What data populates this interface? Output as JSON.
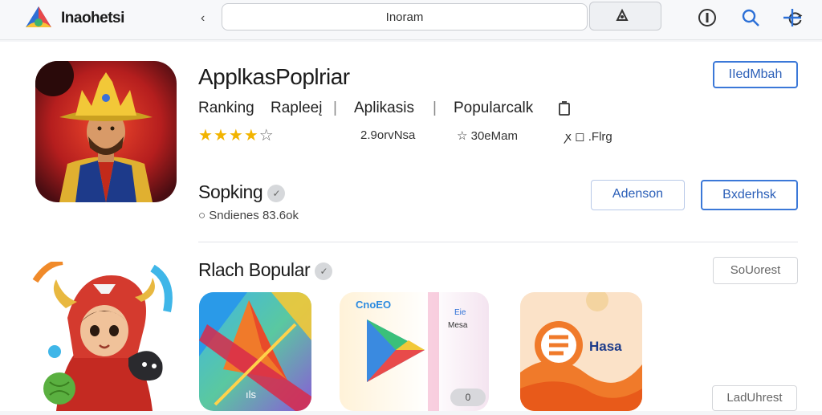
{
  "topbar": {
    "brand": "Inaohetsi",
    "back_glyph": "‹",
    "url": "Inoram",
    "icons": [
      "reload-icon",
      "extension-icon",
      "info-icon",
      "search-icon",
      "plus-icon"
    ]
  },
  "app": {
    "title": "ApplkasPoplriar",
    "meta": [
      "Ranking",
      "Rapleeį",
      "Aplikasis",
      "Popularcalk"
    ],
    "meta_separator": "|",
    "rating": {
      "value": 3.5,
      "max": 5
    },
    "downloads": "2.9orvNsa",
    "rating_count": "☆ 30eMam",
    "extra": "ꭗ ◻ .Flrg",
    "install_button": "IIedMbah"
  },
  "section1": {
    "title": "Sopking",
    "subtitle": "○ Sndienes 83.6ok",
    "button_secondary": "Adenson",
    "button_primary": "Bxderhsk"
  },
  "section2": {
    "title": "Rlach Bopular",
    "see_all_top": "SoUorest",
    "see_all_bottom": "LadUhrest",
    "tiles": [
      {
        "label": "ıls"
      },
      {
        "label": "CnoEO",
        "sublabel1": "Eie",
        "sublabel2": "Mesa",
        "badge": "0"
      },
      {
        "label": "Hasa"
      }
    ]
  },
  "colors": {
    "accent": "#3b78d8",
    "star": "#f2b400",
    "background": "#f4f5f7"
  }
}
